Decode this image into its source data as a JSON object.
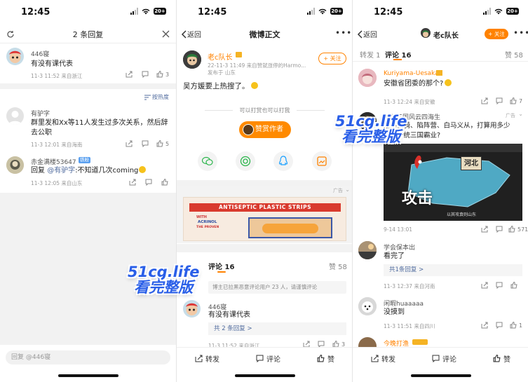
{
  "status_time": "12:45",
  "battery": "20+",
  "panel1": {
    "header_title": "2 条回复",
    "main": {
      "username": "446寝",
      "text": "有没有课代表",
      "meta": "11-3 11:52 来自浙江",
      "likes": "3"
    },
    "sort_label": "按热度",
    "replies": [
      {
        "username": "有驴字",
        "text_line1": "群里发和Xx等11人发生过多次关系，然后辞",
        "text_line2": "去公职",
        "meta": "11-3 12:01 来自海南",
        "likes": "5"
      },
      {
        "username": "赤金满楼53647",
        "badge": "铁粉",
        "text_prefix": "回复 ",
        "mention": "@有驴字",
        "text_rest": ":不知道几次coming",
        "meta": "11-3 12:05 来自山东"
      }
    ],
    "input_placeholder": "回复 @446寝"
  },
  "panel2": {
    "back_label": "返回",
    "title": "微博正文",
    "author": "老c队长",
    "post_meta": "22-11-3 11:49 来自赞就涨停的Harmo...",
    "published_at": "发布于 山东",
    "follow_label": "+ 关注",
    "post_text": "吴方媛要上热搜了。",
    "reward_hint": "可以打赏也可以打我",
    "reward_button": "赞赏作者",
    "ad_label": "广告",
    "ad_banner_text": "ANTISEPTIC PLASTIC STRIPS",
    "ad_small_1": "WITH",
    "ad_small_2": "ACRINOL",
    "ad_small_3": "THE PROVEN",
    "tab_comment": "评论 16",
    "tab_like": "赞 58",
    "notice": "博主已拉黑恶意评论用户 23 人，请谨慎评论",
    "comment": {
      "username": "446寝",
      "text": "有没有课代表",
      "replies_link": "共 2 条回复 >",
      "meta": "11-3 11:52 来自浙江",
      "likes": "3"
    },
    "bottom": {
      "repost": "转发",
      "comment": "评论",
      "like": "赞"
    }
  },
  "panel3": {
    "back_label": "返回",
    "title": "老c队长",
    "follow_label": "+ 关注",
    "tab_repost": "转发 1",
    "tab_comment": "评论 16",
    "tab_like": "赞 58",
    "c1": {
      "username": "Kuriyama-Uesaka",
      "text": "安徽省团委的那个?",
      "meta": "11-3 12:24 来自安徽",
      "likes": "7"
    },
    "ad": {
      "label": "广告",
      "line1": "铁骑三国风云四海生",
      "line2": "拾得铁骑、陷阵营、白马义从，打算用多少",
      "line3": "时间一统三国霸业?",
      "map_label": "河北",
      "attack_text": "攻击",
      "caption": "以其攻袁则山东",
      "meta": "9-14 13:01",
      "likes": "571"
    },
    "c2": {
      "username": "学会保本出",
      "text": "看完了",
      "replies_link": "共1条回复 >",
      "meta": "11-3 12:37 来自河南"
    },
    "c3": {
      "username": "闲暇huaaaaa",
      "text": "没摸到",
      "meta": "11-3 11:51 来自四川",
      "likes": "1"
    },
    "c4": {
      "username": "今晚打渔"
    },
    "bottom": {
      "repost": "转发",
      "comment": "评论",
      "like": "赞"
    }
  },
  "watermark": {
    "line1": "51cg.life",
    "line2": "看完整版"
  },
  "colors": {
    "accent_orange": "#ff8200",
    "link_blue": "#506b9e",
    "watermark_blue": "#2a5fe8"
  }
}
